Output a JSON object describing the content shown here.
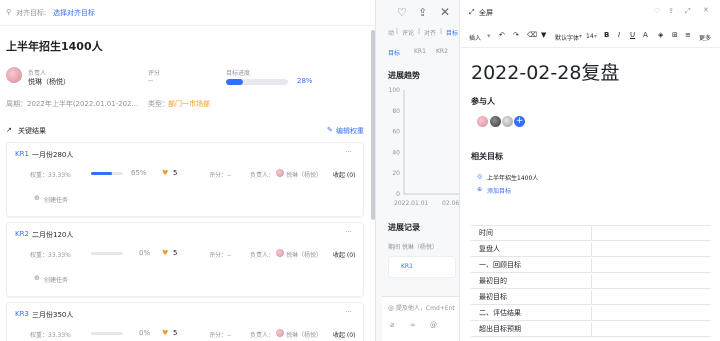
{
  "left": {
    "topbar": {
      "align_label": "对齐目标:",
      "align_link": "选择对齐目标"
    },
    "title": "上半年招生1400人",
    "owner_label": "负责人",
    "owner_name": "悦琳（杨悦）",
    "score_label": "评分",
    "score_value": "--",
    "progress_label": "目标进度",
    "progress_value": "28%",
    "progress_fraction": 0.28,
    "period": "周期：2022年上半年(2022.01.01-202...",
    "type_label": "类型：",
    "type_value": "部门一市场部",
    "kr_header": "关键结果",
    "edit_weight": "编辑权重",
    "krs": [
      {
        "id": "KR1",
        "title": "一月份280人",
        "weight": "权重：33.33%",
        "progress": "65%",
        "progress_fraction": 0.65,
        "confidence": "5",
        "score": "评分：--",
        "owner": "负责人：",
        "owner_name": "悦琳（杨悦）",
        "collect": "收起 (0)",
        "task": "创建任务"
      },
      {
        "id": "KR2",
        "title": "二月份120人",
        "weight": "权重：33.33%",
        "progress": "0%",
        "progress_fraction": 0,
        "confidence": "5",
        "score": "评分：--",
        "owner": "负责人：",
        "owner_name": "悦琳（杨悦）",
        "collect": "收起 (0)",
        "task": "创建任务"
      },
      {
        "id": "KR3",
        "title": "三月份350人",
        "weight": "权重：33.33%",
        "progress": "0%",
        "progress_fraction": 0,
        "confidence": "5",
        "score": "评分：--",
        "owner": "负责人：",
        "owner_name": "悦琳（杨悦）",
        "collect": "收起 (0)"
      }
    ]
  },
  "mid": {
    "top_items": [
      "动",
      "评论",
      "对齐",
      "目标"
    ],
    "tabs": [
      "目标",
      "KR1",
      "KR2"
    ],
    "trend_title": "进展趋势",
    "chart_data": {
      "type": "line",
      "y_ticks": [
        "100",
        "80",
        "60",
        "40",
        "20",
        "0"
      ],
      "x_ticks": [
        "2022.01.01",
        "02.06"
      ],
      "ylim": [
        0,
        100
      ],
      "series": [
        {
          "values": []
        }
      ]
    },
    "record_title": "进展记录",
    "record_row": "期间  悦琳（杨悦）",
    "record_kr": "KR1",
    "comment_placeholder": "@ 提及他人，Cmd+Ent"
  },
  "right": {
    "toolbar_top": {
      "fullscreen": "全屏"
    },
    "toolbar": {
      "insert": "插入",
      "font": "默认字体",
      "size": "14",
      "more": "更多"
    },
    "doc_title": "2022-02-28复盘",
    "participants_heading": "参与人",
    "related_heading": "相关目标",
    "related_goal": "上半年招生1400人",
    "add_goal": "添加目标",
    "table_rows": [
      "时间",
      "复盘人",
      "一、回顾目标",
      "最初目的",
      "最初目标",
      "二、评估结果",
      "超出目标预期"
    ]
  },
  "colors": {
    "accent": "#3370ff",
    "orange": "#f59a23",
    "border": "#e5e6eb"
  }
}
